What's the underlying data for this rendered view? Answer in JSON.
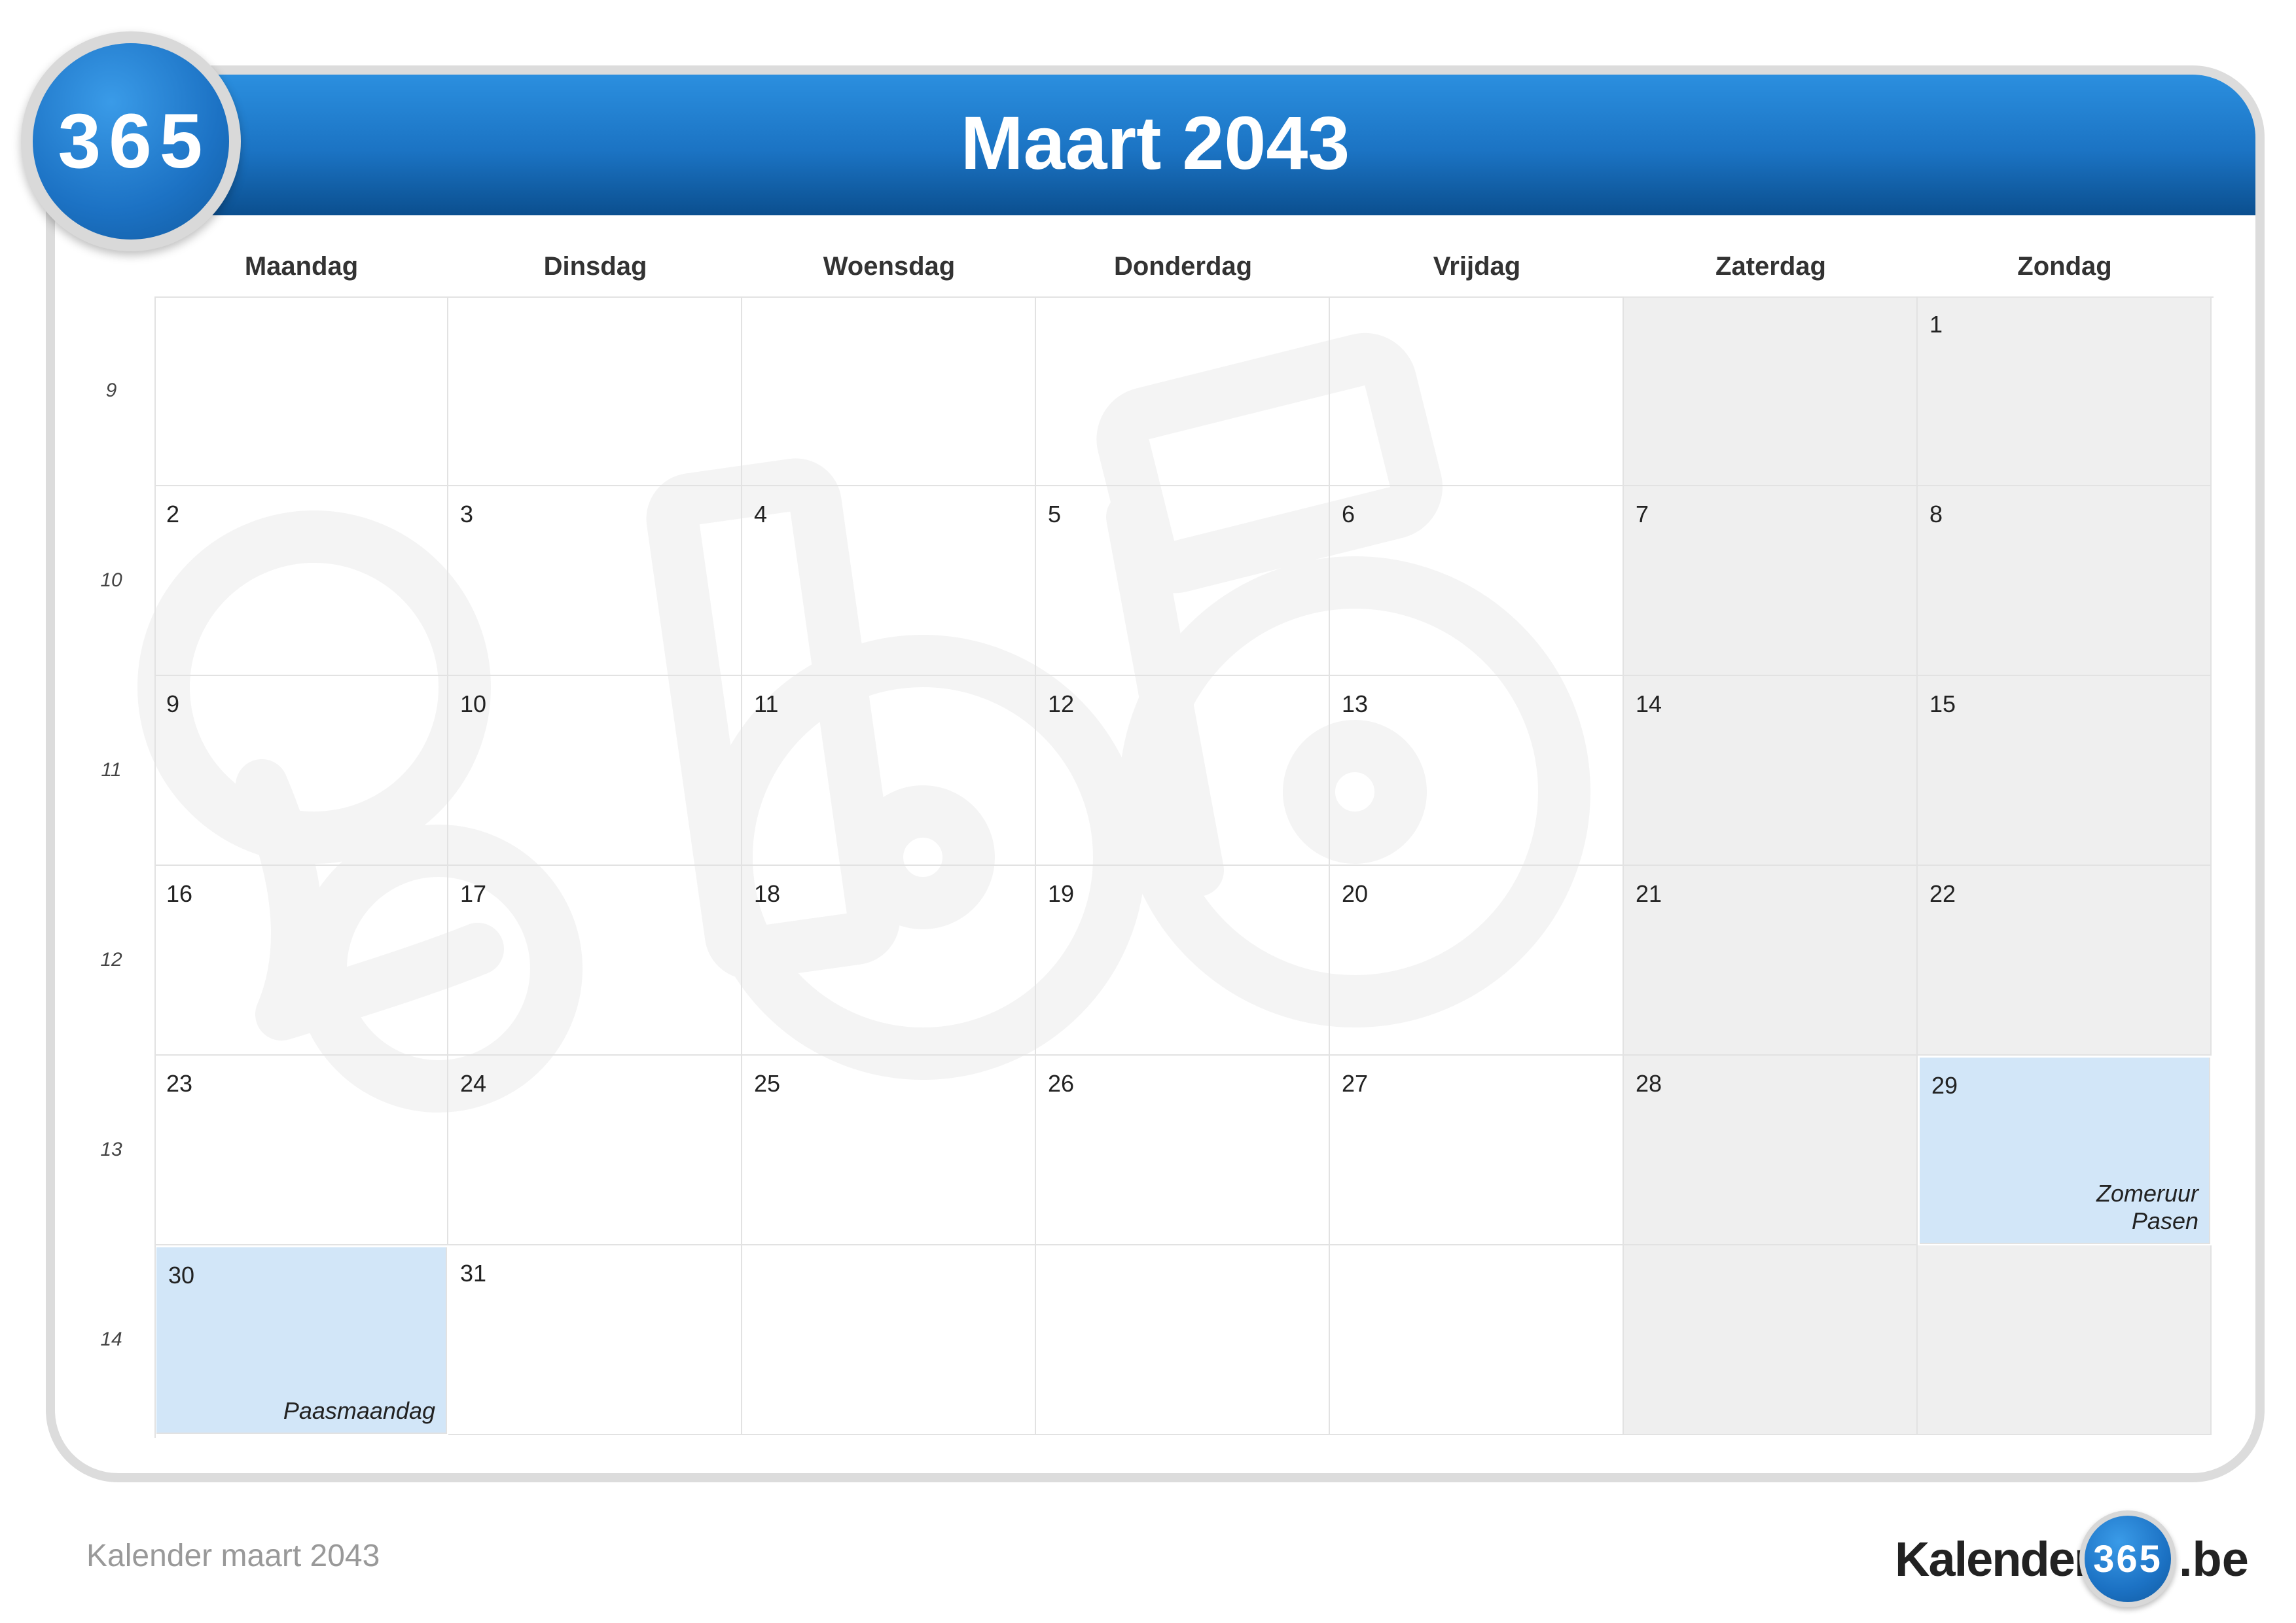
{
  "calendar": {
    "title": "Maart 2043",
    "logo_text": "365",
    "weekdays": [
      "Maandag",
      "Dinsdag",
      "Woensdag",
      "Donderdag",
      "Vrijdag",
      "Zaterdag",
      "Zondag"
    ],
    "weeks": [
      {
        "week_number": "9",
        "days": [
          {
            "day": "",
            "weekend": false,
            "holiday": false,
            "events": []
          },
          {
            "day": "",
            "weekend": false,
            "holiday": false,
            "events": []
          },
          {
            "day": "",
            "weekend": false,
            "holiday": false,
            "events": []
          },
          {
            "day": "",
            "weekend": false,
            "holiday": false,
            "events": []
          },
          {
            "day": "",
            "weekend": false,
            "holiday": false,
            "events": []
          },
          {
            "day": "",
            "weekend": true,
            "holiday": false,
            "events": []
          },
          {
            "day": "1",
            "weekend": true,
            "holiday": false,
            "events": []
          }
        ]
      },
      {
        "week_number": "10",
        "days": [
          {
            "day": "2",
            "weekend": false,
            "holiday": false,
            "events": []
          },
          {
            "day": "3",
            "weekend": false,
            "holiday": false,
            "events": []
          },
          {
            "day": "4",
            "weekend": false,
            "holiday": false,
            "events": []
          },
          {
            "day": "5",
            "weekend": false,
            "holiday": false,
            "events": []
          },
          {
            "day": "6",
            "weekend": false,
            "holiday": false,
            "events": []
          },
          {
            "day": "7",
            "weekend": true,
            "holiday": false,
            "events": []
          },
          {
            "day": "8",
            "weekend": true,
            "holiday": false,
            "events": []
          }
        ]
      },
      {
        "week_number": "11",
        "days": [
          {
            "day": "9",
            "weekend": false,
            "holiday": false,
            "events": []
          },
          {
            "day": "10",
            "weekend": false,
            "holiday": false,
            "events": []
          },
          {
            "day": "11",
            "weekend": false,
            "holiday": false,
            "events": []
          },
          {
            "day": "12",
            "weekend": false,
            "holiday": false,
            "events": []
          },
          {
            "day": "13",
            "weekend": false,
            "holiday": false,
            "events": []
          },
          {
            "day": "14",
            "weekend": true,
            "holiday": false,
            "events": []
          },
          {
            "day": "15",
            "weekend": true,
            "holiday": false,
            "events": []
          }
        ]
      },
      {
        "week_number": "12",
        "days": [
          {
            "day": "16",
            "weekend": false,
            "holiday": false,
            "events": []
          },
          {
            "day": "17",
            "weekend": false,
            "holiday": false,
            "events": []
          },
          {
            "day": "18",
            "weekend": false,
            "holiday": false,
            "events": []
          },
          {
            "day": "19",
            "weekend": false,
            "holiday": false,
            "events": []
          },
          {
            "day": "20",
            "weekend": false,
            "holiday": false,
            "events": []
          },
          {
            "day": "21",
            "weekend": true,
            "holiday": false,
            "events": []
          },
          {
            "day": "22",
            "weekend": true,
            "holiday": false,
            "events": []
          }
        ]
      },
      {
        "week_number": "13",
        "days": [
          {
            "day": "23",
            "weekend": false,
            "holiday": false,
            "events": []
          },
          {
            "day": "24",
            "weekend": false,
            "holiday": false,
            "events": []
          },
          {
            "day": "25",
            "weekend": false,
            "holiday": false,
            "events": []
          },
          {
            "day": "26",
            "weekend": false,
            "holiday": false,
            "events": []
          },
          {
            "day": "27",
            "weekend": false,
            "holiday": false,
            "events": []
          },
          {
            "day": "28",
            "weekend": true,
            "holiday": false,
            "events": []
          },
          {
            "day": "29",
            "weekend": true,
            "holiday": true,
            "events": [
              "Zomeruur",
              "Pasen"
            ]
          }
        ]
      },
      {
        "week_number": "14",
        "days": [
          {
            "day": "30",
            "weekend": false,
            "holiday": true,
            "events": [
              "Paasmaandag"
            ]
          },
          {
            "day": "31",
            "weekend": false,
            "holiday": false,
            "events": []
          },
          {
            "day": "",
            "weekend": false,
            "holiday": false,
            "events": []
          },
          {
            "day": "",
            "weekend": false,
            "holiday": false,
            "events": []
          },
          {
            "day": "",
            "weekend": false,
            "holiday": false,
            "events": []
          },
          {
            "day": "",
            "weekend": true,
            "holiday": false,
            "events": []
          },
          {
            "day": "",
            "weekend": true,
            "holiday": false,
            "events": []
          }
        ]
      }
    ]
  },
  "footer": {
    "caption": "Kalender maart 2043",
    "brand_left": "Kalender",
    "brand_circle": "365",
    "brand_right": ".be"
  },
  "colors": {
    "header_blue": "#1b73c3",
    "weekend_gray": "#ebebeb",
    "holiday_blue": "#d2e6f8",
    "border": "#e2e2e2"
  }
}
